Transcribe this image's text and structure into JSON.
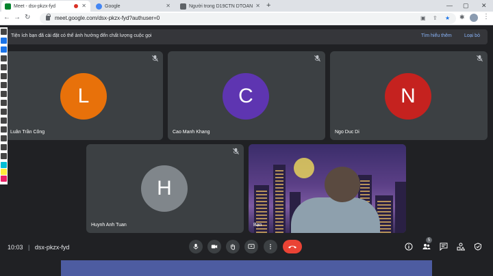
{
  "browser": {
    "tabs": [
      {
        "title": "Meet - dsx-pkzx-fyd",
        "favicon_color": "#00832d"
      },
      {
        "title": "Google",
        "favicon_color": "#4285f4"
      },
      {
        "title": "Người trong D19CTN DTOAN",
        "favicon_color": "#5f6368"
      }
    ],
    "url": "meet.google.com/dsx-pkzx-fyd?authuser=0"
  },
  "banner": {
    "message": "Tiện ích bạn đã cài đặt có thể ảnh hưởng đến chất lượng cuộc gọi",
    "learn_more": "Tìm hiểu thêm",
    "dismiss": "Loại bỏ"
  },
  "participants": [
    {
      "name": "Luân Trần Công",
      "initial": "L",
      "color": "#e8710a",
      "muted": true
    },
    {
      "name": "Cao Manh Khang",
      "initial": "C",
      "color": "#5e35b1",
      "muted": true
    },
    {
      "name": "Ngo Duc Di",
      "initial": "N",
      "color": "#c5221f",
      "muted": true
    },
    {
      "name": "Huynh Anh Tuan",
      "initial": "H",
      "color": "#80868b",
      "muted": true
    },
    {
      "name": "Bạn",
      "video": true
    }
  ],
  "meeting": {
    "time": "10:03",
    "code": "dsx-pkzx-fyd",
    "people_count": "5"
  },
  "colors": {
    "background": "#202124",
    "tile": "#3c4043",
    "end_call": "#ea4335",
    "link": "#8ab4f8"
  }
}
